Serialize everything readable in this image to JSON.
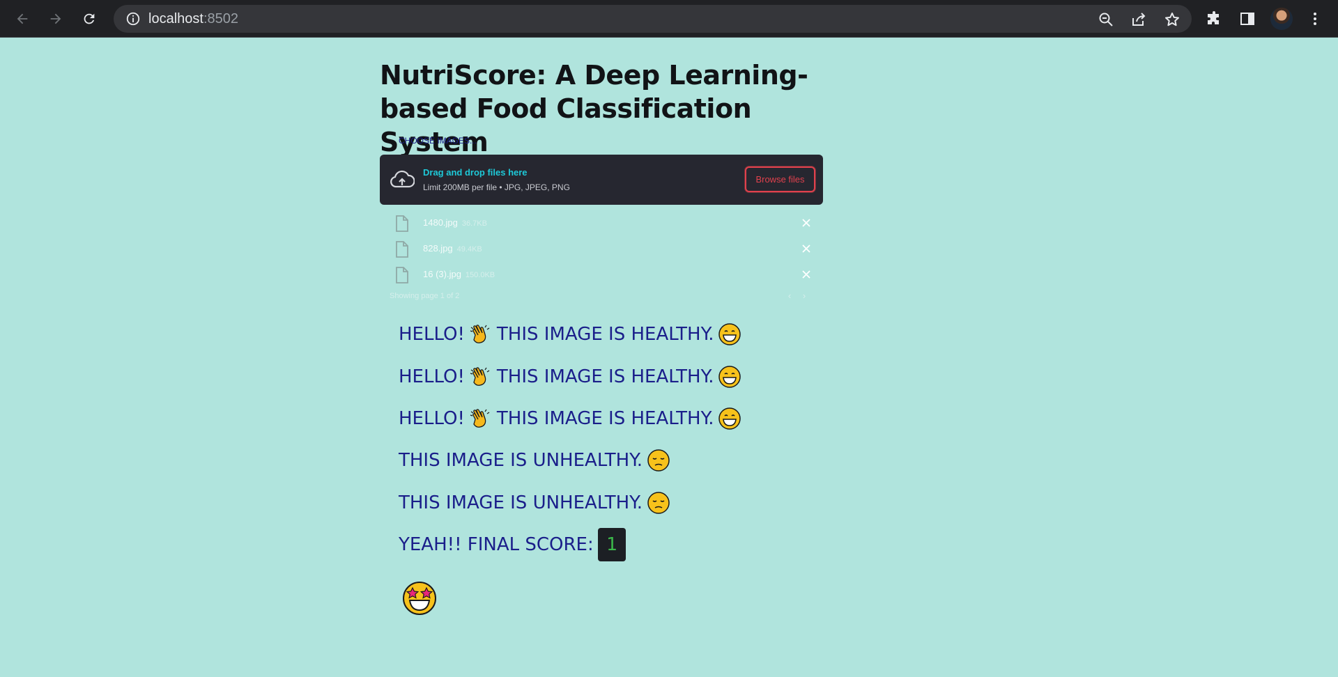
{
  "browser": {
    "url_host": "localhost",
    "url_port": ":8502",
    "icons": [
      "back-icon",
      "forward-icon",
      "reload-icon",
      "info-icon",
      "zoom-out-icon",
      "share-icon",
      "star-icon",
      "extensions-icon",
      "side-panel-icon",
      "avatar",
      "menu-icon"
    ]
  },
  "app": {
    "title": "NutriScore: A Deep Learning-based Food Classification System",
    "uploader": {
      "label": "CHOOSE IMAGES...",
      "drop_title": "Drag and drop files here",
      "drop_subtitle": "Limit 200MB per file • JPG, JPEG, PNG",
      "browse_label": "Browse files"
    },
    "files": [
      {
        "name": "1480.jpg",
        "size": "36.7KB"
      },
      {
        "name": "828.jpg",
        "size": "49.4KB"
      },
      {
        "name": "16 (3).jpg",
        "size": "150.0KB"
      }
    ],
    "pagination": "Showing page 1 of 2",
    "results": [
      {
        "prefix": "HELLO!",
        "text": "THIS IMAGE IS HEALTHY.",
        "kind": "healthy"
      },
      {
        "prefix": "HELLO!",
        "text": "THIS IMAGE IS HEALTHY.",
        "kind": "healthy"
      },
      {
        "prefix": "HELLO!",
        "text": "THIS IMAGE IS HEALTHY.",
        "kind": "healthy"
      },
      {
        "prefix": "",
        "text": "THIS IMAGE IS UNHEALTHY.",
        "kind": "unhealthy"
      },
      {
        "prefix": "",
        "text": "THIS IMAGE IS UNHEALTHY.",
        "kind": "unhealthy"
      }
    ],
    "final_label": "YEAH!! FINAL SCORE:",
    "final_score": "1",
    "colors": {
      "background": "#b0e4dd",
      "text": "#1a1e8a",
      "accent": "#e0414d",
      "score": "#3bb84a"
    }
  }
}
